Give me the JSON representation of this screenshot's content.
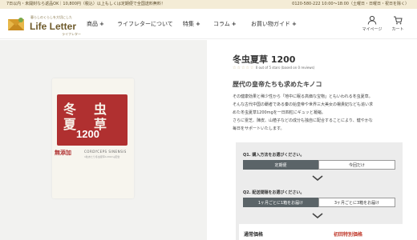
{
  "topbar": {
    "promo": "7日以内・未開封なら返品OK｜10,800円（税込）以上もしくは定期便で全国送料無料！",
    "tel": "0120-580-222 10:00～18:00（土曜日・日曜日・祝日を除く）"
  },
  "logo": {
    "tagline": "暮らしのくらしを大切にした",
    "brand": "Life Letter",
    "sub": "ライフレター"
  },
  "nav": {
    "products": "商品",
    "about": "ライフレターについて",
    "features": "特集",
    "column": "コラム",
    "guide": "お買い物ガイド",
    "plus": "+"
  },
  "header_icons": {
    "mypage": "マイページ",
    "cart": "カート"
  },
  "package": {
    "seal_chars": [
      "冬",
      "虫",
      "夏",
      "草"
    ],
    "number": "1200",
    "mutenka": "無添加",
    "latin": "CORDYCEPS SINENSIS",
    "fine": "1粒あたり冬虫夏草1200mg配合"
  },
  "product": {
    "title": "冬虫夏草 1200",
    "stars": "☆☆☆☆☆",
    "rating_text": "0 out of 5 stars (based on 0 reviews)",
    "catch": "歴代の皇帝たちも求めたキノコ",
    "desc_lines": [
      "その健康効果と稀少性から「地中に眠る高価な宝物」ともいわれる冬虫夏草。",
      "そんな古代中国の覇者である秦の始皇帝や世界三大美女の楊貴妃なども追い求",
      "めた冬虫夏草1200mgを一日四粒にギュッと凝縮。",
      "さらに霊芝、陳皮、山楂子などの成分も独自に配合することにより、健やかな",
      "毎日をサポートいたします。"
    ]
  },
  "options": {
    "q1": "Q1. 購入方法をお選びください。",
    "q1_opt1": "定期便",
    "q1_opt2": "今回だけ",
    "q2": "Q2. 配送間隔をお選びください。",
    "q2_opt1": "1ヶ月ごとに1箱をお届け",
    "q2_opt2": "3ヶ月ごとに3箱をお届け"
  },
  "price": {
    "label": "通常価格",
    "first_time": "初回特別価格"
  },
  "colors": {
    "topbar_bg": "#f4ecd6",
    "brand_brown": "#6e5a2b",
    "seal_red": "#b03030",
    "selected_option": "#5b6468",
    "price_red": "#c0392b"
  }
}
